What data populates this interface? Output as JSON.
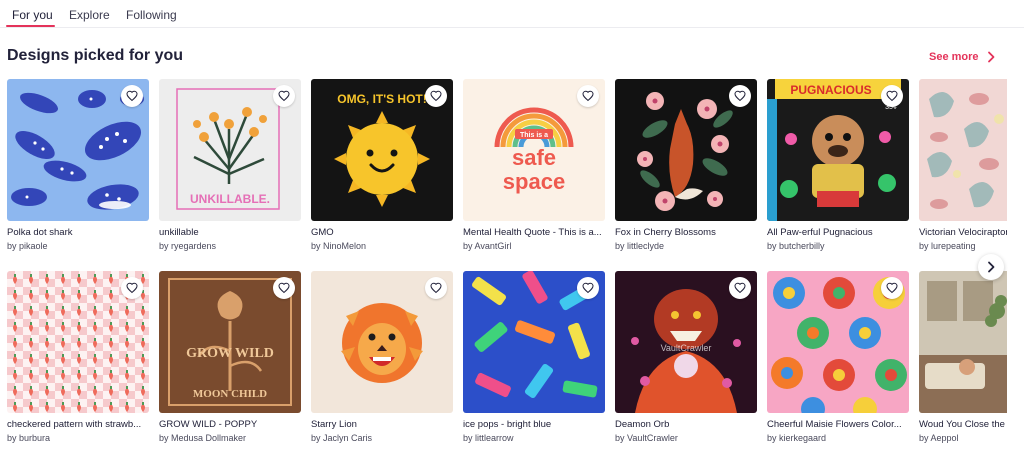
{
  "tabs": [
    {
      "label": "For you",
      "active": true
    },
    {
      "label": "Explore",
      "active": false
    },
    {
      "label": "Following",
      "active": false
    }
  ],
  "section": {
    "title": "Designs picked for you",
    "see_more": "See more"
  },
  "colors": {
    "accent": "#e4335a"
  },
  "icons": {
    "favorite": "heart-icon",
    "see_more": "chevron-right-icon",
    "next": "chevron-right-icon"
  },
  "cards": [
    {
      "title": "Polka dot shark",
      "artist": "by pikaole"
    },
    {
      "title": "unkillable",
      "artist": "by ryegardens"
    },
    {
      "title": "GMO",
      "artist": "by NinoMelon"
    },
    {
      "title": "Mental Health Quote - This is a...",
      "artist": "by AvantGirl"
    },
    {
      "title": "Fox in Cherry Blossoms",
      "artist": "by littleclyde"
    },
    {
      "title": "All Paw-erful Pugnacious",
      "artist": "by butcherbilly"
    },
    {
      "title": "Victorian Velociraptors",
      "artist": "by lurepeating"
    },
    {
      "title": "checkered pattern with strawb...",
      "artist": "by burbura"
    },
    {
      "title": "GROW WILD - POPPY",
      "artist": "by Medusa Dollmaker"
    },
    {
      "title": "Starry Lion",
      "artist": "by Jaclyn Caris"
    },
    {
      "title": "ice pops - bright blue",
      "artist": "by littlearrow"
    },
    {
      "title": "Deamon Orb",
      "artist": "by VaultCrawler"
    },
    {
      "title": "Cheerful Maisie Flowers Color...",
      "artist": "by kierkegaard"
    },
    {
      "title": "Woud You Close the Door",
      "artist": "by Aeppol"
    }
  ],
  "art_text": {
    "unkillable": "UNKILLABLE.",
    "gmo": "OMG, IT'S HOT!",
    "safe_line1": "This is a",
    "safe_line2": "safe",
    "safe_line3": "space",
    "grow_wild": "GROW WILD",
    "moon_child": "MOON CHILD",
    "pug_badge": "PUGNACIOUS",
    "pug_price": "35¢",
    "vault": "VaultCrawler"
  }
}
